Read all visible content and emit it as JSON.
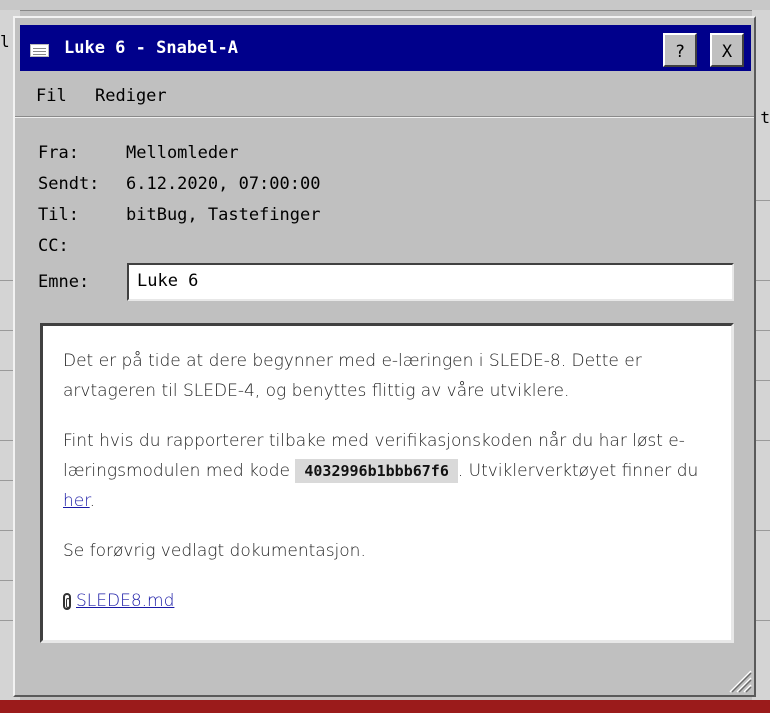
{
  "window": {
    "title": "Luke 6 - Snabel-A"
  },
  "titlebar": {
    "help_label": "?",
    "close_label": "X"
  },
  "menu": {
    "items": [
      "Fil",
      "Rediger"
    ]
  },
  "headers": {
    "from_label": "Fra:",
    "from_value": "Mellomleder",
    "sent_label": "Sendt:",
    "sent_value": "6.12.2020, 07:00:00",
    "to_label": "Til:",
    "to_value": "bitBug, Tastefinger",
    "cc_label": "CC:",
    "cc_value": "",
    "subject_label": "Emne:",
    "subject_value": "Luke 6"
  },
  "body": {
    "paragraph1": "Det er på tide at dere begynner med e-læringen i SLEDE-8. Dette er arvtageren til SLEDE-4, og benyttes flittig av våre utviklere.",
    "paragraph2_part1": "Fint hvis du rapporterer tilbake med verifikasjonskoden når du har løst e-læringsmodulen med kode",
    "code": "4032996b1bbb67f6",
    "paragraph2_part2": ". Utviklerverktøyet finner du",
    "link_text": "her",
    "paragraph2_part3": ".",
    "paragraph3": "Se forøvrig vedlagt dokumentasjon.",
    "attachment_name": "SLEDE8.md"
  },
  "background": {
    "left_glyph": "l",
    "right_glyph": "t"
  }
}
